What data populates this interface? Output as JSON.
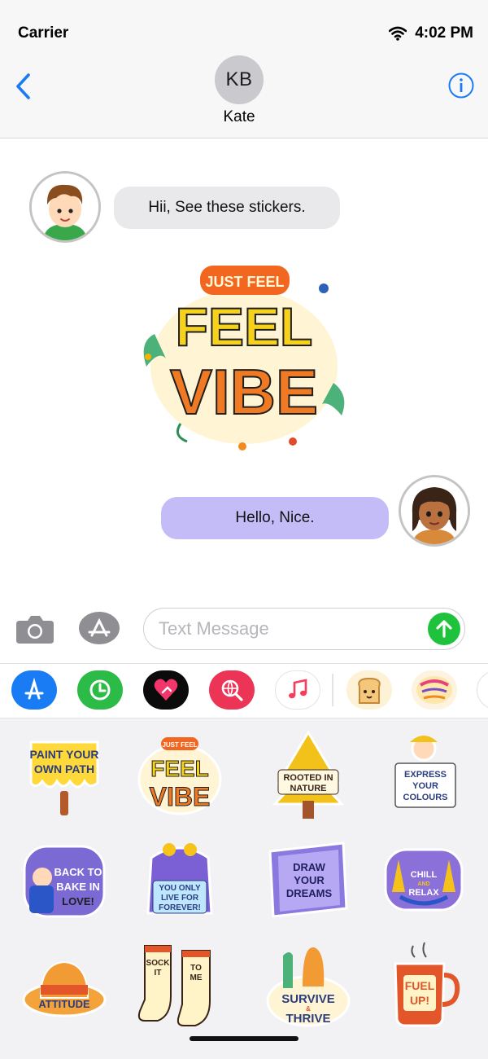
{
  "status_bar": {
    "carrier": "Carrier",
    "time": "4:02 PM"
  },
  "header": {
    "avatar_initials": "KB",
    "contact_name": "Kate"
  },
  "messages": [
    {
      "direction": "incoming",
      "text": "Hii, See these stickers."
    },
    {
      "direction": "incoming",
      "type": "sticker",
      "sticker_text": [
        "JUST FEEL",
        "FEEL",
        "VIBE"
      ]
    },
    {
      "direction": "outgoing",
      "text": "Hello, Nice."
    }
  ],
  "composer": {
    "placeholder": "Text Message",
    "value": ""
  },
  "app_drawer": {
    "icons": [
      "app-store",
      "activity",
      "digital-touch",
      "images-search",
      "music",
      "sticker-pack-toast",
      "sticker-pack-start-where-you-are"
    ]
  },
  "colors": {
    "accent": "#1a7cf5",
    "incoming_bubble": "#e9e9eb",
    "outgoing_bubble": "#c3bcf6",
    "send": "#1fc23c"
  },
  "stickers": [
    {
      "lines": [
        "PAINT YOUR",
        "OWN PATH"
      ]
    },
    {
      "lines": [
        "JUST FEEL",
        "FEEL",
        "VIBE"
      ]
    },
    {
      "lines": [
        "ROOTED IN",
        "NATURE"
      ]
    },
    {
      "lines": [
        "EXPRESS",
        "YOUR",
        "COLOURS"
      ]
    },
    {
      "lines": [
        "BACK TO",
        "BAKE IN",
        "LOVE!"
      ]
    },
    {
      "lines": [
        "YOU ONLY",
        "LIVE FOR",
        "FOREVER!"
      ]
    },
    {
      "lines": [
        "DRAW",
        "YOUR",
        "DREAMS"
      ]
    },
    {
      "lines": [
        "CHILL",
        "AND",
        "RELAX"
      ]
    },
    {
      "lines": [
        "ATTITUDE"
      ]
    },
    {
      "lines": [
        "SOCK",
        "IT",
        "TO",
        "ME"
      ]
    },
    {
      "lines": [
        "SURVIVE",
        "&",
        "THRIVE"
      ]
    },
    {
      "lines": [
        "FUEL",
        "UP!"
      ]
    }
  ]
}
